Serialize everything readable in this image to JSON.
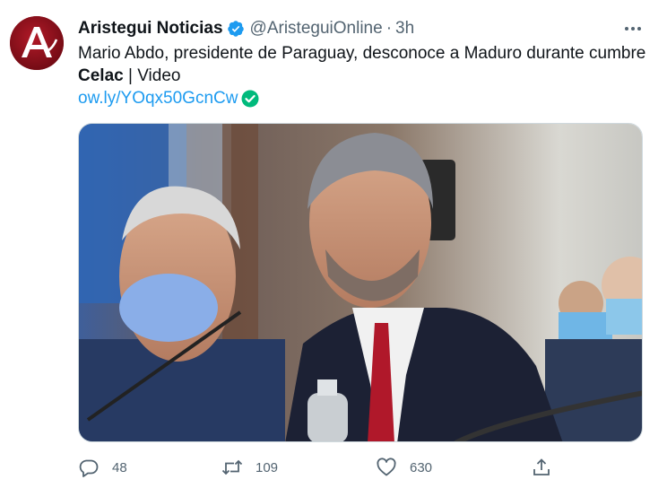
{
  "tweet": {
    "display_name": "Aristegui Noticias",
    "handle": "@AristeguiOnline",
    "separator": "·",
    "time": "3h",
    "text_before": "Mario Abdo, presidente de Paraguay, desconoce a Maduro durante cumbre ",
    "text_bold": "Celac",
    "text_after": " | Video",
    "link": "ow.ly/YOqx50GcnCw"
  },
  "avatar": {
    "letter": "A",
    "bg_color": "#8b0f1a"
  },
  "icons": {
    "verified": "verified-badge-icon",
    "link_check": "check-circle-icon",
    "more": "more-options-icon"
  },
  "actions": {
    "reply": {
      "icon": "reply-icon",
      "count": "48"
    },
    "retweet": {
      "icon": "retweet-icon",
      "count": "109"
    },
    "like": {
      "icon": "heart-icon",
      "count": "630"
    },
    "share": {
      "icon": "share-icon"
    }
  },
  "colors": {
    "accent": "#1d9bf0",
    "secondary_text": "#536471",
    "check_green": "#00ba7c"
  }
}
